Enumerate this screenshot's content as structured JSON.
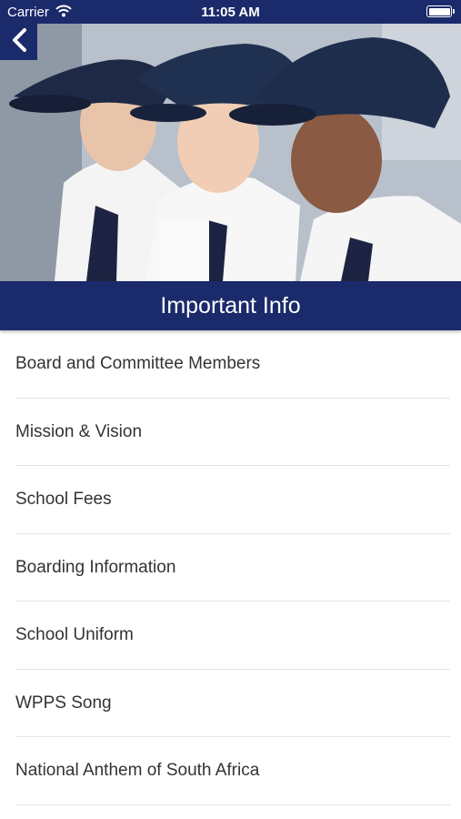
{
  "status_bar": {
    "carrier": "Carrier",
    "time": "11:05 AM",
    "wifi_icon": "wifi-icon",
    "battery_icon": "battery-icon"
  },
  "header": {
    "back_icon": "chevron-left-icon",
    "title": "Important Info",
    "hero_image": "photo of three schoolboys in navy caps and white shirts"
  },
  "menu": {
    "items": [
      {
        "label": "Board and Committee Members"
      },
      {
        "label": "Mission & Vision"
      },
      {
        "label": "School Fees"
      },
      {
        "label": "Boarding Information"
      },
      {
        "label": "School Uniform"
      },
      {
        "label": "WPPS Song"
      },
      {
        "label": "National Anthem of South Africa"
      }
    ]
  },
  "colors": {
    "brand_navy": "#1b2a6b",
    "background": "#ffffff",
    "text": "#333333",
    "divider": "#e4e4e4"
  }
}
